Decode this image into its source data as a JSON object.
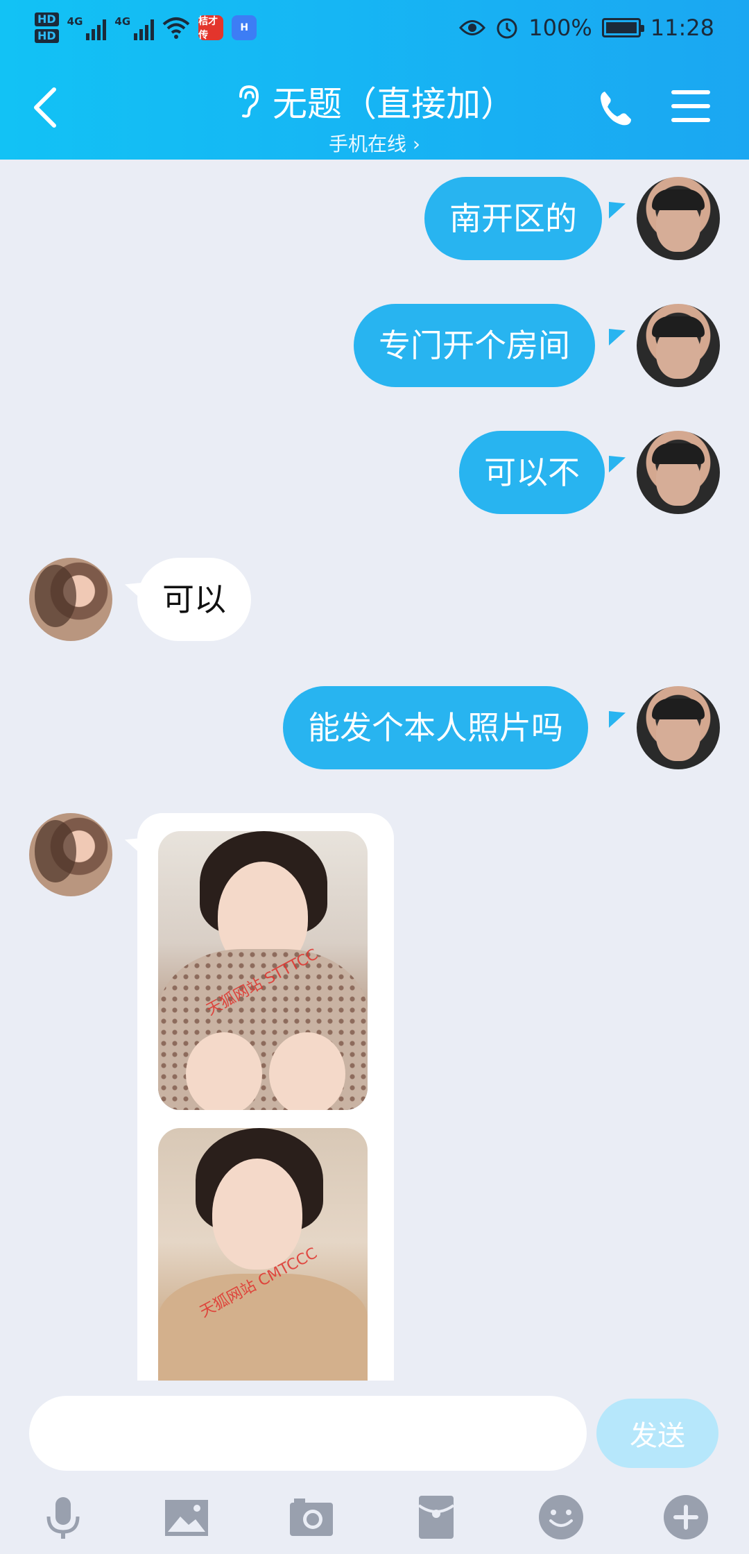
{
  "status_bar": {
    "hd1": "HD",
    "hd2": "HD",
    "net1": "4G",
    "net2": "4G",
    "app_icon_1": "桔才传",
    "app_icon_2": "H",
    "battery": "100%",
    "time": "11:28"
  },
  "header": {
    "title": "无题（直接加）",
    "subtitle": "手机在线 ›"
  },
  "messages": [
    {
      "side": "sent",
      "text": "南开区的"
    },
    {
      "side": "sent",
      "text": "专门开个房间"
    },
    {
      "side": "sent",
      "text": "可以不"
    },
    {
      "side": "recv",
      "text": "可以"
    },
    {
      "side": "sent",
      "text": "能发个本人照片吗"
    },
    {
      "side": "recv",
      "type": "images",
      "watermark1": "天狐网站 STTTCC",
      "watermark2": "天狐网站 CMTCCC"
    }
  ],
  "input": {
    "value": "",
    "send_label": "发送"
  },
  "toolbar": [
    "mic-icon",
    "image-icon",
    "camera-icon",
    "red-packet-icon",
    "emoji-icon",
    "plus-icon"
  ],
  "colors": {
    "header_start": "#12c2f5",
    "header_end": "#1ba7f2",
    "sent_bubble": "#28b4f0",
    "background": "#eaedf5"
  }
}
